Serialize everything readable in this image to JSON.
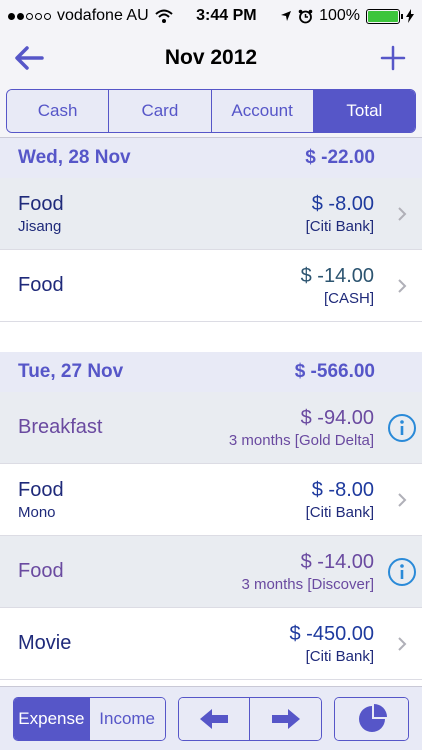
{
  "status": {
    "carrier": "vodafone AU",
    "time": "3:44 PM",
    "battery": "100%",
    "battery_level": 1.0
  },
  "nav": {
    "title": "Nov 2012"
  },
  "segments": [
    "Cash",
    "Card",
    "Account",
    "Total"
  ],
  "days": [
    {
      "date": "Wed, 28 Nov",
      "total": "$ -22.00",
      "items": [
        {
          "category": "Food",
          "sub": "Jisang",
          "amount": "$ -8.00",
          "account": "[Citi Bank]"
        },
        {
          "category": "Food",
          "sub": "",
          "amount": "$ -14.00",
          "account": "[CASH]"
        }
      ]
    },
    {
      "date": "Tue, 27 Nov",
      "total": "$ -566.00",
      "items": [
        {
          "category": "Breakfast",
          "sub": "",
          "amount": "$ -94.00",
          "account": "3 months [Gold Delta]"
        },
        {
          "category": "Food",
          "sub": "Mono",
          "amount": "$ -8.00",
          "account": "[Citi Bank]"
        },
        {
          "category": "Food",
          "sub": "",
          "amount": "$ -14.00",
          "account": "3 months [Discover]"
        },
        {
          "category": "Movie",
          "sub": "",
          "amount": "$ -450.00",
          "account": "[Citi Bank]"
        }
      ]
    }
  ],
  "toolbar": {
    "expense": "Expense",
    "income": "Income"
  },
  "colors": {
    "accent": "#5656c8",
    "header_bg": "#e8eaf6",
    "info": "#2a8ad8"
  }
}
